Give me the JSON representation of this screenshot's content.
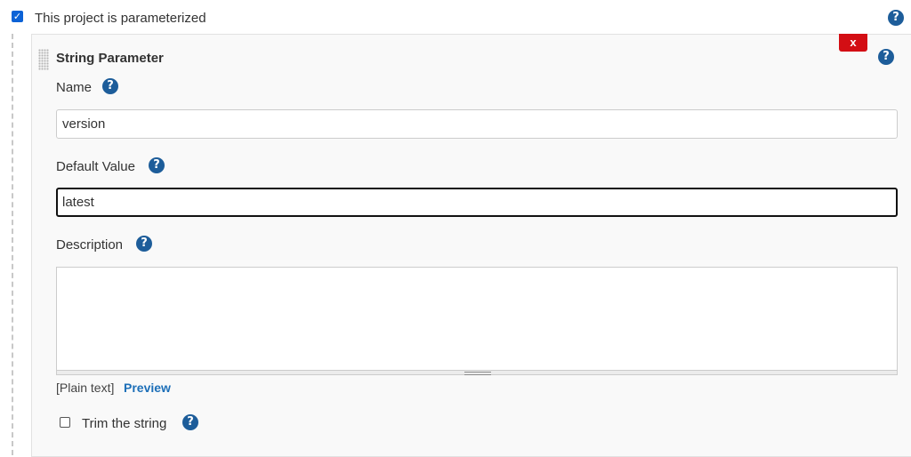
{
  "parameterized": {
    "checked": true,
    "label": "This project is parameterized"
  },
  "parameter": {
    "title": "String Parameter",
    "delete_label": "x",
    "name_label": "Name",
    "name_value": "version",
    "default_label": "Default Value",
    "default_value": "latest",
    "description_label": "Description",
    "description_value": "",
    "markup_label": "[Plain text]",
    "preview_label": "Preview",
    "trim_label": "Trim the string",
    "trim_checked": false
  },
  "help_glyph": "?",
  "colors": {
    "help_icon": "#1d5d9a",
    "delete_button": "#d30e14",
    "checkbox": "#0b62d6",
    "link": "#1d6fb8"
  }
}
